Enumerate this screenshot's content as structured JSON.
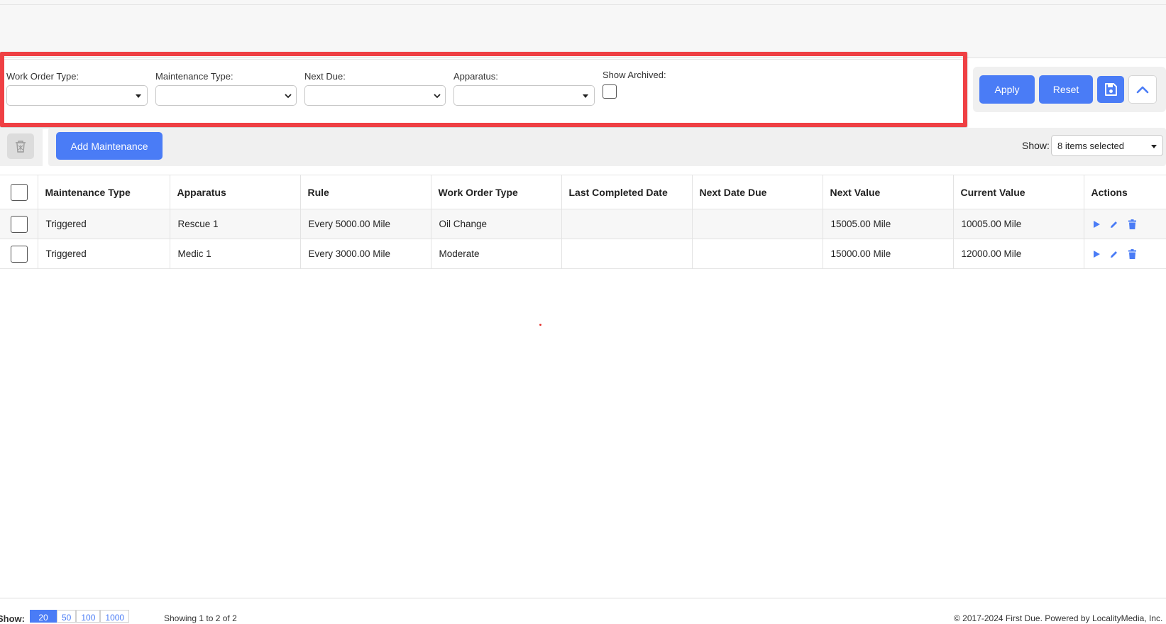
{
  "filters": {
    "work_order_type": {
      "label": "Work Order Type:",
      "value": ""
    },
    "maintenance_type": {
      "label": "Maintenance Type:",
      "value": ""
    },
    "next_due": {
      "label": "Next Due:",
      "value": ""
    },
    "apparatus": {
      "label": "Apparatus:",
      "value": ""
    },
    "show_archived": {
      "label": "Show Archived:",
      "checked": false
    }
  },
  "actions": {
    "apply_label": "Apply",
    "reset_label": "Reset",
    "save_icon": "save-icon",
    "collapse_icon": "chevron-up-icon"
  },
  "toolbar": {
    "add_label": "Add Maintenance",
    "show_label": "Show:",
    "show_value": "8 items selected"
  },
  "table": {
    "columns": [
      "Maintenance Type",
      "Apparatus",
      "Rule",
      "Work Order Type",
      "Last Completed Date",
      "Next Date Due",
      "Next Value",
      "Current Value",
      "Actions"
    ],
    "rows": [
      {
        "maintenance_type": "Triggered",
        "apparatus": "Rescue 1",
        "rule": "Every 5000.00 Mile",
        "work_order_type": "Oil Change",
        "last_completed": "",
        "next_date_due": "",
        "next_value": "15005.00 Mile",
        "current_value": "10005.00 Mile"
      },
      {
        "maintenance_type": "Triggered",
        "apparatus": "Medic 1",
        "rule": "Every 3000.00 Mile",
        "work_order_type": "Moderate",
        "last_completed": "",
        "next_date_due": "",
        "next_value": "15000.00 Mile",
        "current_value": "12000.00 Mile"
      }
    ]
  },
  "footer": {
    "show_label": "Show:",
    "page_sizes": [
      "20",
      "50",
      "100",
      "1000"
    ],
    "showing": "Showing 1 to 2 of 2",
    "copyright": "© 2017-2024 First Due. Powered by LocalityMedia, Inc."
  },
  "colors": {
    "accent": "#4a7cf6",
    "highlight": "#ef4044"
  }
}
